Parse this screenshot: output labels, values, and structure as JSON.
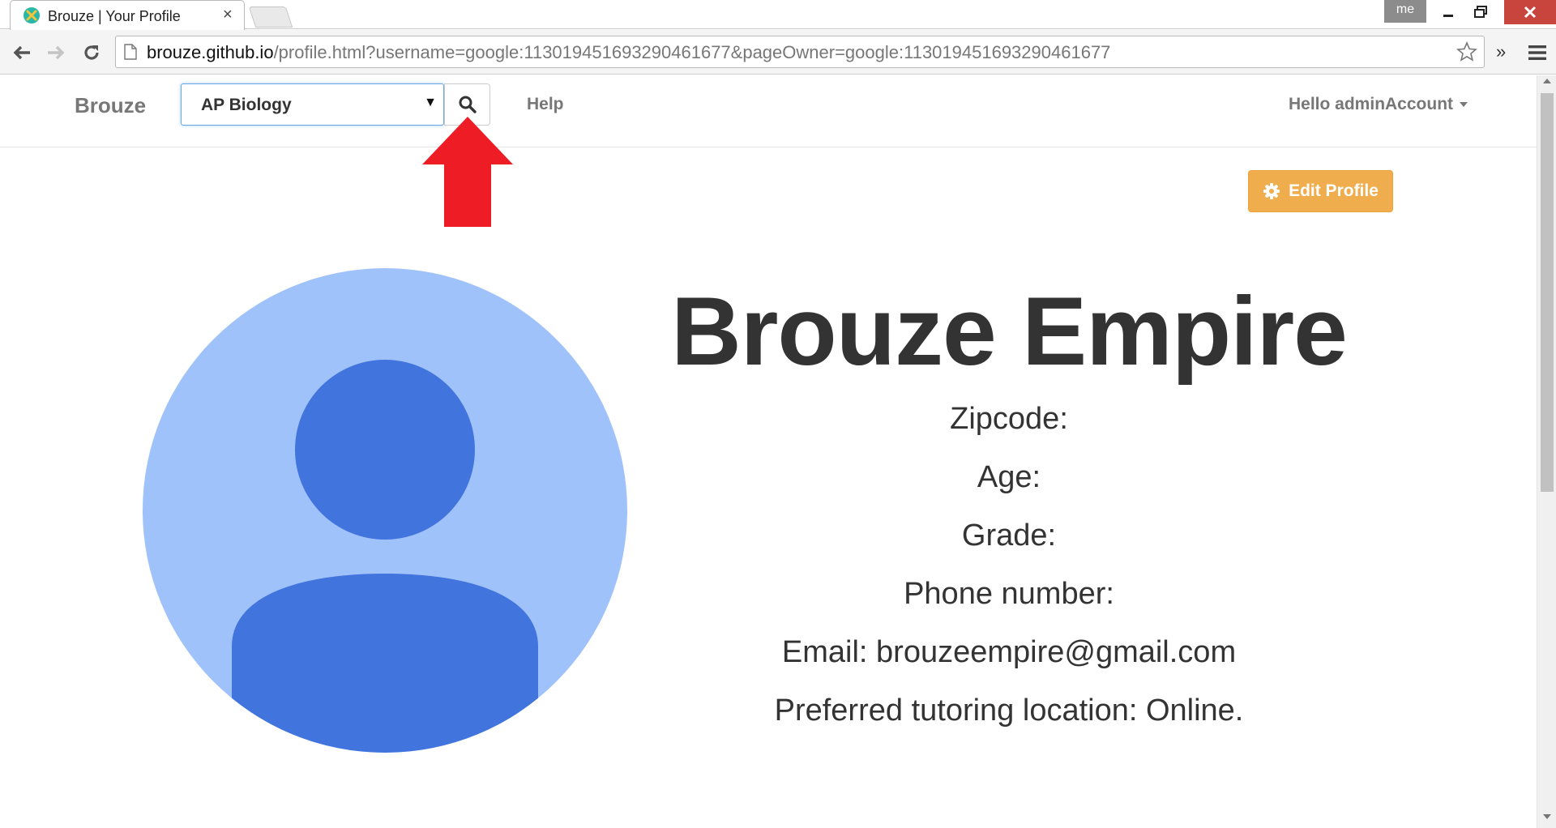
{
  "browser": {
    "tab_title": "Brouze | Your Profile",
    "tab_close": "×",
    "profile_badge": "me",
    "url_host": "brouze.github.io",
    "url_rest": "/profile.html?username=google:113019451693290461677&pageOwner=google:113019451693290461677",
    "overflow": "»"
  },
  "navbar": {
    "brand": "Brouze",
    "subject_selected": "AP Biology",
    "subject_caret": "▼",
    "help": "Help",
    "greeting": "Hello adminAccount"
  },
  "profile": {
    "edit_button": "Edit Profile",
    "name": "Brouze Empire",
    "zipcode": "Zipcode:",
    "age": "Age:",
    "grade": "Grade:",
    "phone": "Phone number:",
    "email": "Email: brouzeempire@gmail.com",
    "location": "Preferred tutoring location: Online."
  },
  "colors": {
    "edit_button": "#f0ad4e",
    "avatar_bg": "#a0c2fb",
    "avatar_fg": "#4274de",
    "annotation_arrow": "#ee1c25",
    "window_close": "#c7453d"
  },
  "icons": {
    "favicon": "brouze-logo-icon",
    "search": "search-icon",
    "edit": "gear-icon",
    "back": "back-arrow-icon",
    "forward": "forward-arrow-icon",
    "reload": "reload-icon",
    "bookmark": "star-icon",
    "menu": "hamburger-menu-icon"
  }
}
